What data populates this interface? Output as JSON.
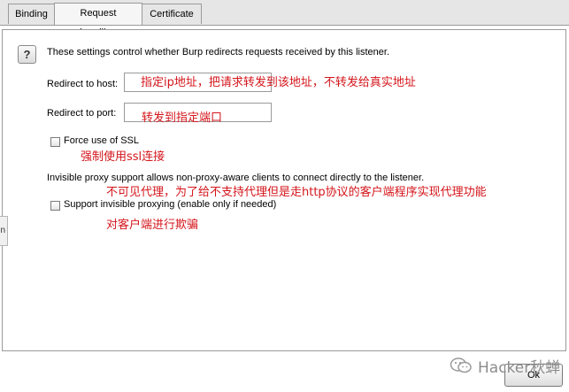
{
  "tabs": [
    {
      "label": "Binding",
      "active": false
    },
    {
      "label": "Request handling",
      "active": true
    },
    {
      "label": "Certificate",
      "active": false
    }
  ],
  "panel": {
    "help_glyph": "?",
    "description": "These settings control whether Burp redirects requests received by this listener.",
    "redirect_host_label": "Redirect to host:",
    "redirect_host_value": "",
    "redirect_port_label": "Redirect to port:",
    "redirect_port_value": "",
    "force_ssl_label": "Force use of SSL",
    "force_ssl_checked": false,
    "invisible_desc": "Invisible proxy support allows non-proxy-aware clients to connect directly to the listener.",
    "invisible_label": "Support invisible proxying (enable only if needed)",
    "invisible_checked": false
  },
  "annotations": {
    "host": "指定ip地址，把请求转发到该地址，不转发给真实地址",
    "port": "转发到指定端口",
    "ssl": "强制使用ssl连接",
    "invisible": "不可见代理，为了给不支持代理但是走http协议的客户端程序实现代理功能",
    "deceive": "对客户端进行欺骗"
  },
  "side_handle_text": "n",
  "ok_label": "Ok",
  "watermark": {
    "text": "Hacker秋蝉",
    "icon": "wechat-icon"
  },
  "colors": {
    "annotation": "#d4151b",
    "tab_bg": "#e6e6e6",
    "border": "#9a9a9a"
  }
}
